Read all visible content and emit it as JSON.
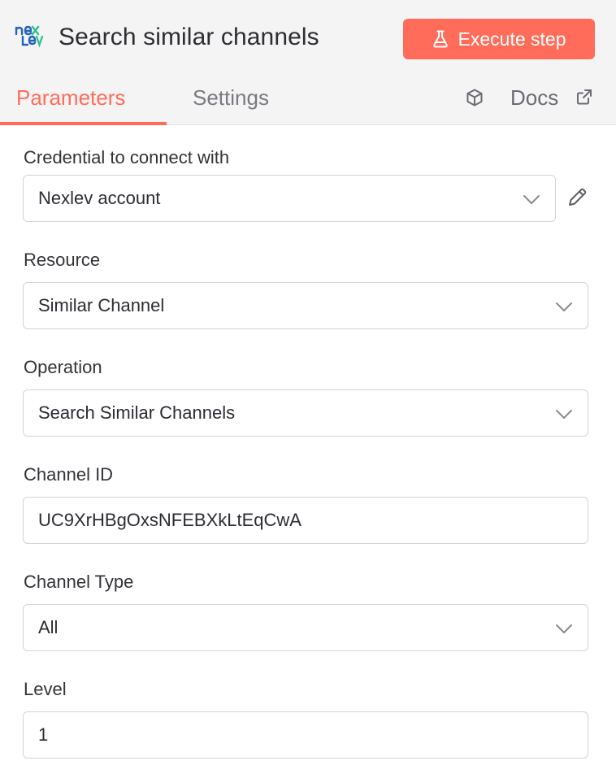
{
  "header": {
    "title": "Search similar channels",
    "logo_icon": "nexlev-logo-icon",
    "execute_label": "Execute step",
    "execute_color": "#ff6d5a",
    "execute_icon": "flask-icon"
  },
  "tabs": [
    {
      "label": "Parameters",
      "active": true
    },
    {
      "label": "Settings",
      "active": false
    }
  ],
  "docs": {
    "label": "Docs",
    "cube_icon": "cube-icon",
    "external_icon": "external-link-icon"
  },
  "fields": {
    "credential": {
      "label": "Credential to connect with",
      "value": "Nexlev account"
    },
    "resource": {
      "label": "Resource",
      "value": "Similar Channel"
    },
    "operation": {
      "label": "Operation",
      "value": "Search Similar Channels"
    },
    "channel_id": {
      "label": "Channel ID",
      "value": "UC9XrHBgOxsNFEBXkLtEqCwA"
    },
    "channel_type": {
      "label": "Channel Type",
      "value": "All"
    },
    "level": {
      "label": "Level",
      "value": "1"
    }
  },
  "accent_color": "#ff6d5a"
}
